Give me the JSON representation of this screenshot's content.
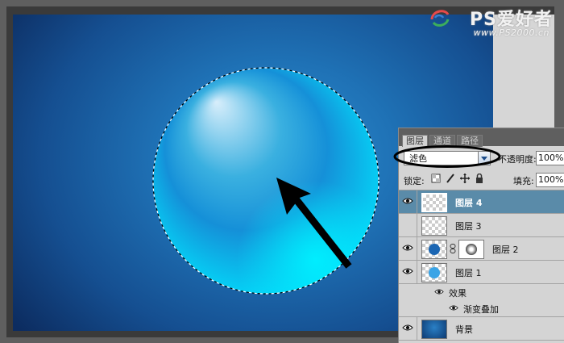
{
  "watermark": {
    "logo": "PS爱好者",
    "url": "www.PS2000.cn"
  },
  "colors": {
    "selected_layer": "#5a8ba9",
    "canvas_center": "#2f8fd0",
    "canvas_edge": "#0c2c60",
    "circle_glow": "#00e5ff"
  },
  "layers_panel": {
    "tabs": [
      {
        "label": "图层"
      },
      {
        "label": "通道"
      },
      {
        "label": "路径"
      }
    ],
    "blend_mode": "滤色",
    "opacity_label": "不透明度:",
    "opacity_value": "100%",
    "lock_label": "锁定:",
    "lock_icons": [
      "transparency-lock-icon",
      "brush-lock-icon",
      "move-lock-icon",
      "padlock-icon"
    ],
    "fill_label": "填充:",
    "fill_value": "100%",
    "layers": [
      {
        "name": "图层 4",
        "selected": true
      },
      {
        "name": "图层 3",
        "selected": false
      },
      {
        "name": "图层 2",
        "selected": false,
        "has_mask": true
      },
      {
        "name": "图层 1",
        "selected": false
      },
      {
        "name": "背景",
        "selected": false
      }
    ],
    "effects_label": "效果",
    "effect_item": "渐变叠加"
  }
}
